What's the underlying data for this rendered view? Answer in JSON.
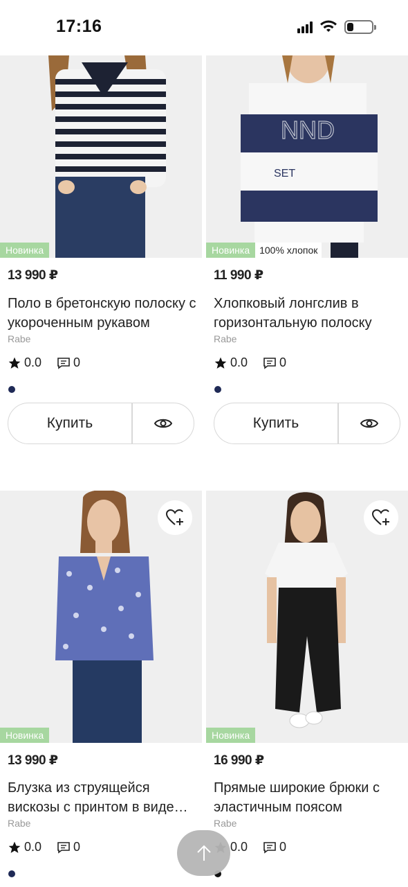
{
  "status_bar": {
    "time": "17:16"
  },
  "labels": {
    "badge_new": "Новинка",
    "buy": "Купить"
  },
  "products": [
    {
      "price": "13 990 ₽",
      "title": "Поло в бретонскую полоску с укороченным рукавом",
      "brand": "Rabe",
      "rating": "0.0",
      "reviews": "0",
      "badge_extra": "",
      "color_dot": "#1f2a56"
    },
    {
      "price": "11 990 ₽",
      "title": "Хлопковый лонгслив в горизонтальную полоску",
      "brand": "Rabe",
      "rating": "0.0",
      "reviews": "0",
      "badge_extra": "100% хлопок",
      "color_dot": "#1f2a56"
    },
    {
      "price": "13 990 ₽",
      "title": "Блузка из струящейся вискозы с принтом в виде бабочек",
      "brand": "Rabe",
      "rating": "0.0",
      "reviews": "0",
      "badge_extra": "",
      "color_dot": "#1f2a56"
    },
    {
      "price": "16 990 ₽",
      "title": "Прямые широкие брюки с эластичным поясом",
      "brand": "Rabe",
      "rating": "0.0",
      "reviews": "0",
      "badge_extra": "",
      "color_dot": "#111111"
    }
  ],
  "icons": {
    "favorite": "heart-plus-icon",
    "view": "eye-icon",
    "star": "star-icon",
    "comment": "comment-icon",
    "scroll_top": "arrow-up-icon"
  }
}
